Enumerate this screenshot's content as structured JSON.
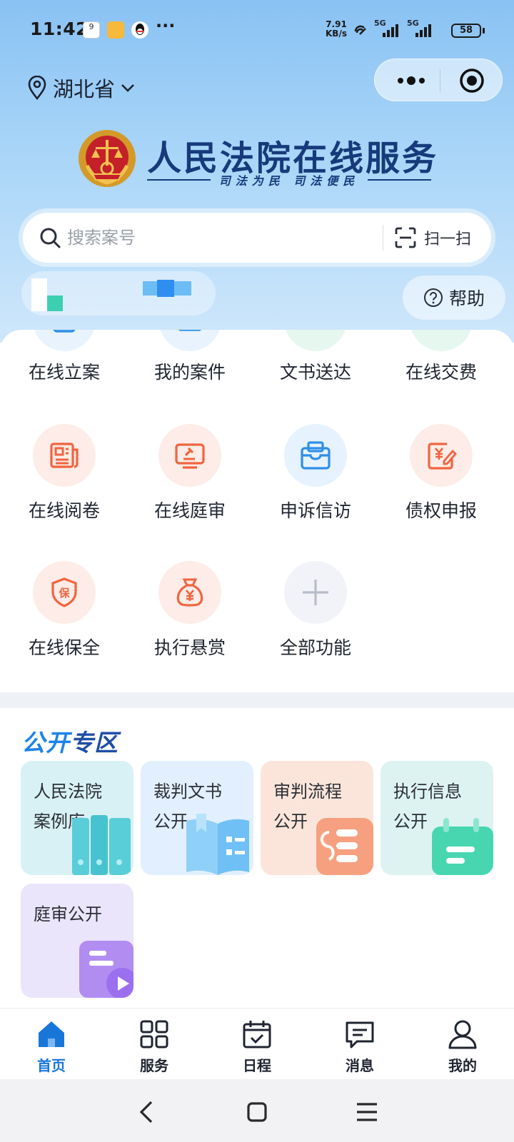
{
  "status_bar": {
    "time": "11:42",
    "more": "···",
    "net_speed_value": "7.91",
    "net_speed_unit": "KB/s",
    "signal_1": "5G",
    "signal_2": "5G",
    "battery": "58"
  },
  "header": {
    "location": "湖北省",
    "app_title": "人民法院在线服务",
    "slogan": "司法为民  司法便民"
  },
  "search": {
    "placeholder": "搜索案号",
    "scan_label": "扫一扫"
  },
  "help": {
    "label": "帮助"
  },
  "services": [
    {
      "label": "在线立案",
      "icon": "file-case-icon"
    },
    {
      "label": "我的案件",
      "icon": "folder-icon"
    },
    {
      "label": "文书送达",
      "icon": "document-check-icon"
    },
    {
      "label": "在线交费",
      "icon": "payment-icon"
    },
    {
      "label": "在线阅卷",
      "icon": "newspaper-icon"
    },
    {
      "label": "在线庭审",
      "icon": "gavel-monitor-icon"
    },
    {
      "label": "申诉信访",
      "icon": "mailbox-icon"
    },
    {
      "label": "债权申报",
      "icon": "yen-edit-icon"
    },
    {
      "label": "在线保全",
      "icon": "shield-icon"
    },
    {
      "label": "执行悬赏",
      "icon": "money-bag-icon"
    },
    {
      "label": "全部功能",
      "icon": "plus-icon"
    }
  ],
  "public_zone": {
    "title_part1": "公开",
    "title_part2": "专区",
    "tiles": [
      {
        "line1": "人民法院",
        "line2": "案例库",
        "icon": "binders-icon",
        "color": "#d8f1f4"
      },
      {
        "line1": "裁判文书",
        "line2": "公开",
        "icon": "open-book-icon",
        "color": "#e2efff"
      },
      {
        "line1": "审判流程",
        "line2": "公开",
        "icon": "flow-icon",
        "color": "#fbe5da"
      },
      {
        "line1": "执行信息",
        "line2": "公开",
        "icon": "calendar-icon",
        "color": "#ddf3f1"
      },
      {
        "line1": "庭审公开",
        "line2": "",
        "icon": "video-icon",
        "color": "#ebe5fb"
      }
    ]
  },
  "tabs": [
    {
      "label": "首页",
      "icon": "home-icon",
      "active": true
    },
    {
      "label": "服务",
      "icon": "grid-icon",
      "active": false
    },
    {
      "label": "日程",
      "icon": "calendar-check-icon",
      "active": false
    },
    {
      "label": "消息",
      "icon": "message-icon",
      "active": false
    },
    {
      "label": "我的",
      "icon": "user-icon",
      "active": false
    }
  ],
  "colors": {
    "accent": "#1976d9",
    "title_blue": "#163a7a",
    "orange_icon": "#f0643f",
    "blue_icon": "#2f8fe8"
  }
}
